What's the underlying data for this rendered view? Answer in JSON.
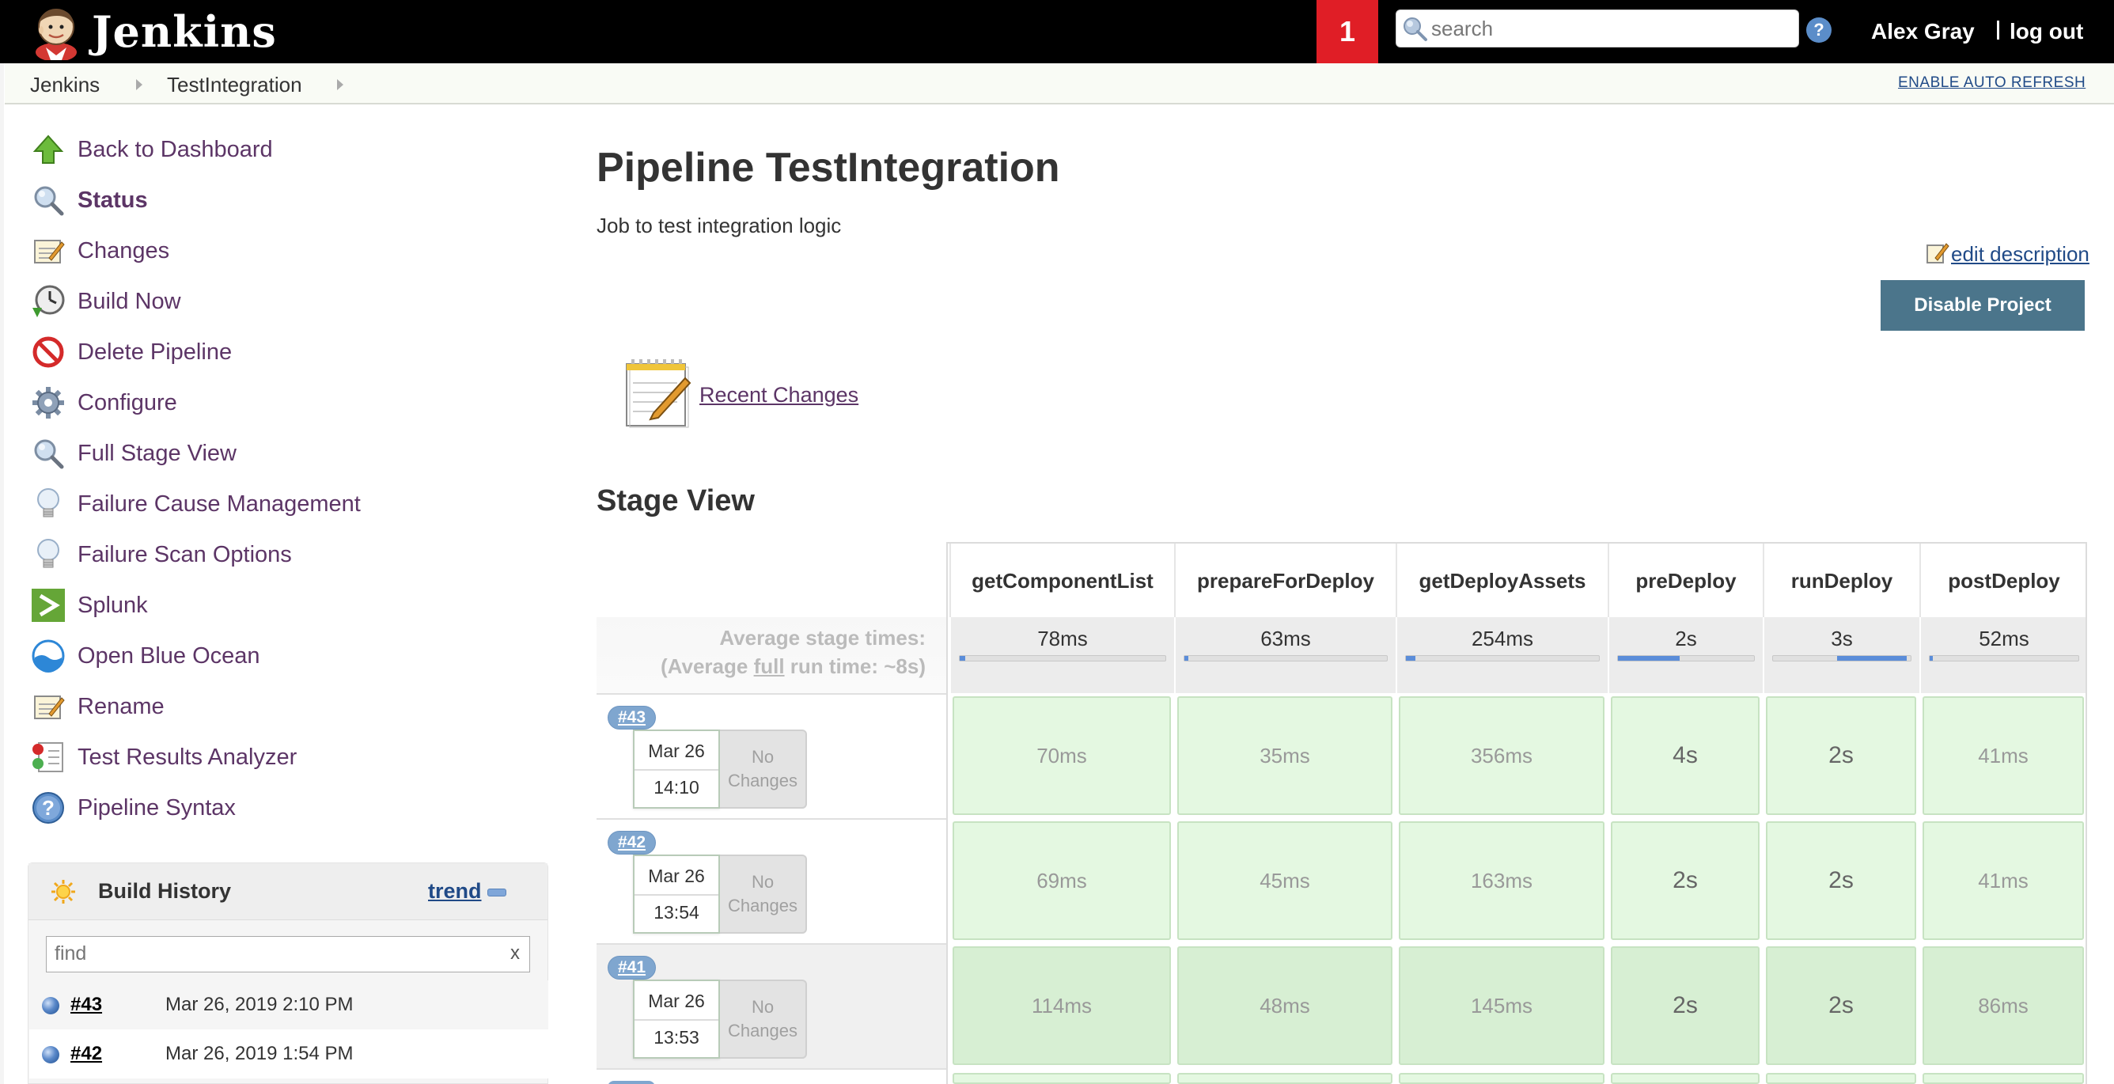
{
  "header": {
    "logo_text": "Jenkins",
    "notification_count": "1",
    "search_placeholder": "search",
    "help": "?",
    "user": "Alex Gray",
    "logout": "log out"
  },
  "breadcrumb": {
    "items": [
      "Jenkins",
      "TestIntegration"
    ],
    "auto_refresh": "ENABLE AUTO REFRESH"
  },
  "sidebar": {
    "tasks": [
      {
        "label": "Back to Dashboard",
        "icon": "up-arrow-icon"
      },
      {
        "label": "Status",
        "icon": "magnifier-icon"
      },
      {
        "label": "Changes",
        "icon": "notepad-icon"
      },
      {
        "label": "Build Now",
        "icon": "clock-icon"
      },
      {
        "label": "Delete Pipeline",
        "icon": "no-entry-icon"
      },
      {
        "label": "Configure",
        "icon": "gear-icon"
      },
      {
        "label": "Full Stage View",
        "icon": "magnifier-icon"
      },
      {
        "label": "Failure Cause Management",
        "icon": "lightbulb-icon"
      },
      {
        "label": "Failure Scan Options",
        "icon": "lightbulb-icon"
      },
      {
        "label": "Splunk",
        "icon": "splunk-icon"
      },
      {
        "label": "Open Blue Ocean",
        "icon": "blue-ocean-icon"
      },
      {
        "label": "Rename",
        "icon": "notepad-icon"
      },
      {
        "label": "Test Results Analyzer",
        "icon": "test-results-icon"
      },
      {
        "label": "Pipeline Syntax",
        "icon": "help-icon"
      }
    ]
  },
  "build_history": {
    "title": "Build History",
    "trend": "trend",
    "filter_placeholder": "find",
    "filter_clear": "x",
    "builds": [
      {
        "number": "#43",
        "date": "Mar 26, 2019 2:10 PM"
      },
      {
        "number": "#42",
        "date": "Mar 26, 2019 1:54 PM"
      }
    ]
  },
  "main": {
    "title": "Pipeline TestIntegration",
    "description": "Job to test integration logic",
    "edit_description": "edit description",
    "disable_button": "Disable Project",
    "recent_changes": "Recent Changes",
    "stage_view_title": "Stage View"
  },
  "stage_view": {
    "avg_label_line1": "Average stage times:",
    "avg_label_line2_pre": "(Average ",
    "avg_label_line2_full": "full",
    "avg_label_line2_post": " run time: ~8s)",
    "stages": [
      {
        "name": "getComponentList",
        "avg": "78ms",
        "avg_fraction": 0.026
      },
      {
        "name": "prepareForDeploy",
        "avg": "63ms",
        "avg_fraction": 0.021
      },
      {
        "name": "getDeployAssets",
        "avg": "254ms",
        "avg_fraction": 0.05
      },
      {
        "name": "preDeploy",
        "avg": "2s",
        "avg_fraction": 0.45
      },
      {
        "name": "runDeploy",
        "avg": "3s",
        "avg_fraction": 0.5
      },
      {
        "name": "postDeploy",
        "avg": "52ms",
        "avg_fraction": 0.017
      }
    ],
    "no_changes": "No Changes",
    "builds": [
      {
        "badge": "#43",
        "day": "Mar 26",
        "time": "14:10",
        "durations": [
          "70ms",
          "35ms",
          "356ms",
          "4s",
          "2s",
          "41ms"
        ]
      },
      {
        "badge": "#42",
        "day": "Mar 26",
        "time": "13:54",
        "durations": [
          "69ms",
          "45ms",
          "163ms",
          "2s",
          "2s",
          "41ms"
        ]
      },
      {
        "badge": "#41",
        "day": "Mar 26",
        "time": "13:53",
        "durations": [
          "114ms",
          "48ms",
          "145ms",
          "2s",
          "2s",
          "86ms"
        ]
      }
    ]
  },
  "colors": {
    "header_bg": "#000000",
    "notification": "#e01e26",
    "disable_button": "#4b758b",
    "stage_success": "#e4f8e1",
    "link": "#204a87",
    "task_link": "#5c3566"
  }
}
